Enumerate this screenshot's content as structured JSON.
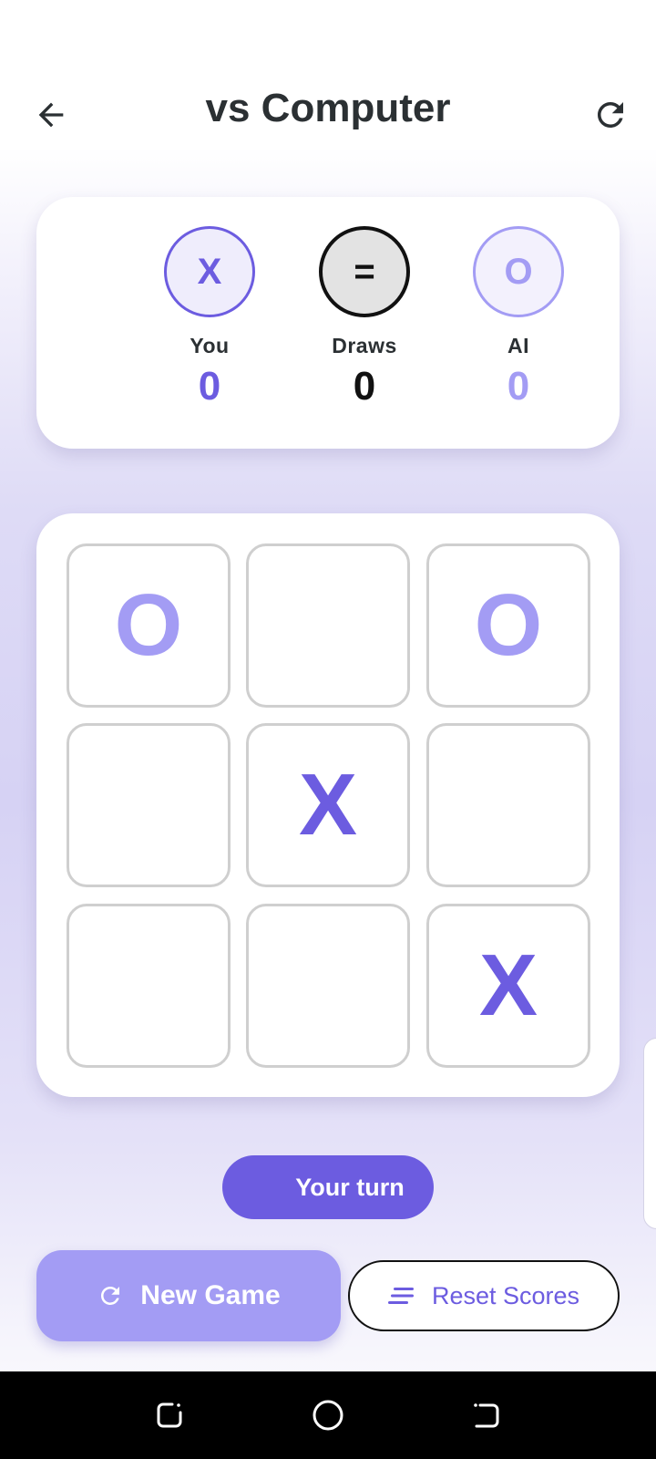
{
  "header": {
    "title": "vs Computer",
    "back_icon": "arrow-left-icon",
    "restart_icon": "refresh-icon"
  },
  "scoreboard": {
    "you": {
      "symbol": "X",
      "label": "You",
      "score": "0"
    },
    "draws": {
      "symbol": "=",
      "label": "Draws",
      "score": "0"
    },
    "ai": {
      "symbol": "O",
      "label": "AI",
      "score": "0"
    }
  },
  "board": {
    "cells": [
      "O",
      "",
      "O",
      "",
      "X",
      "",
      "",
      "",
      "X"
    ]
  },
  "status": {
    "text": "Your turn"
  },
  "buttons": {
    "new_game": "New Game",
    "reset_scores": "Reset Scores"
  },
  "colors": {
    "accent": "#6c5ce0",
    "accent_light": "#a39cf4",
    "text_dark": "#2b3033",
    "cell_border": "#cfcfcf"
  },
  "nav": {
    "recents_icon": "recents-icon",
    "home_icon": "home-icon",
    "back_icon": "system-back-icon"
  }
}
